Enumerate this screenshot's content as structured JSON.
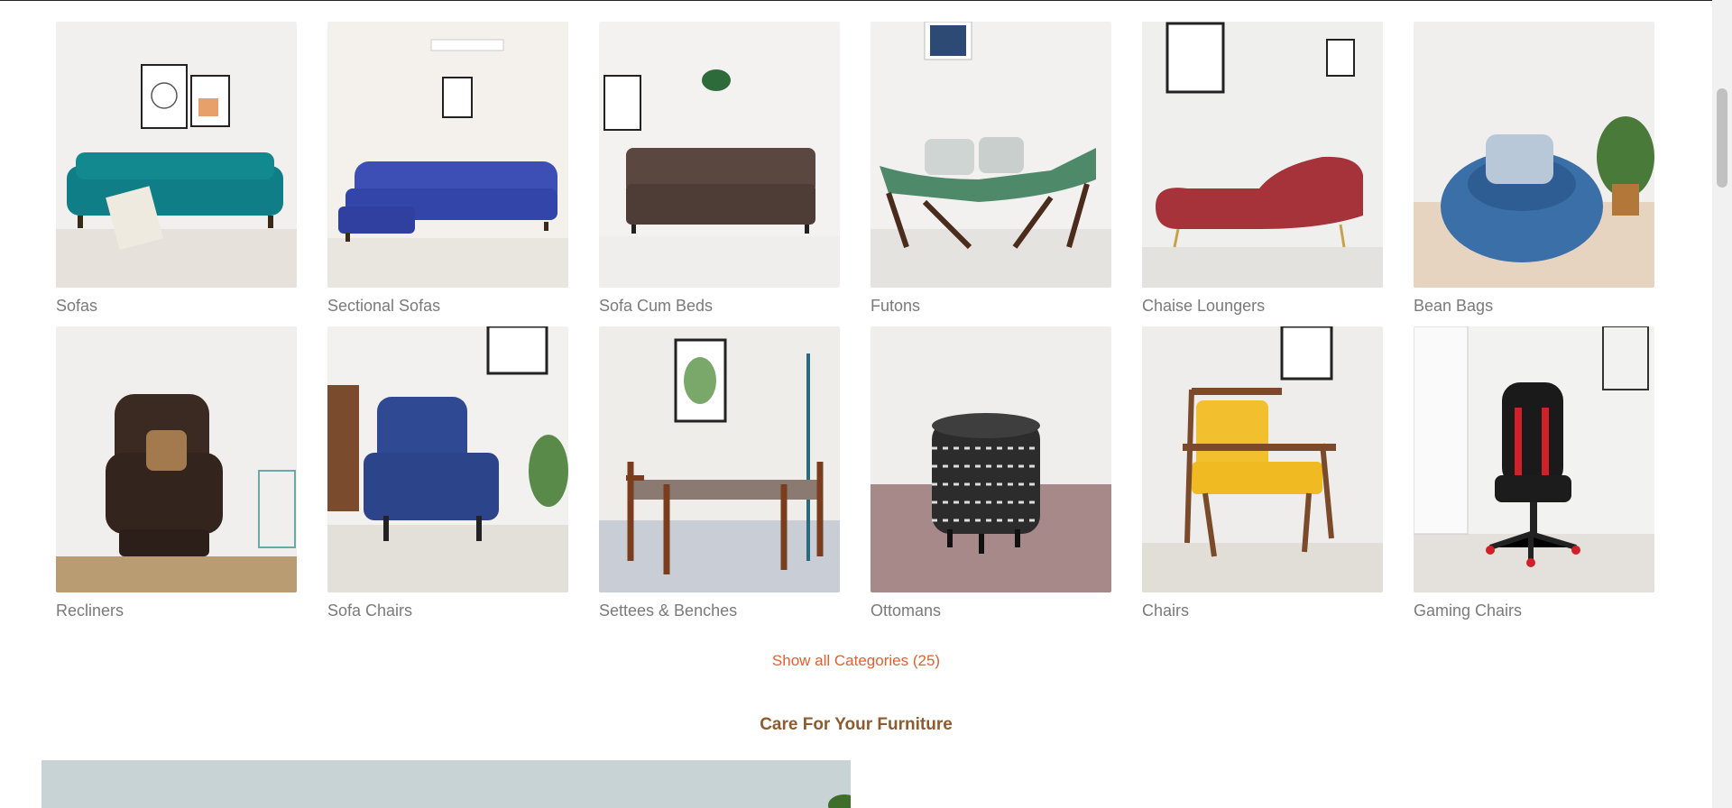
{
  "categories": [
    {
      "label": "Sofas",
      "icon": "sofa-teal-image"
    },
    {
      "label": "Sectional Sofas",
      "icon": "sectional-sofa-blue-image"
    },
    {
      "label": "Sofa Cum Beds",
      "icon": "sofa-cum-bed-brown-image"
    },
    {
      "label": "Futons",
      "icon": "futon-green-image"
    },
    {
      "label": "Chaise Loungers",
      "icon": "chaise-lounger-red-image"
    },
    {
      "label": "Bean Bags",
      "icon": "bean-bag-blue-image"
    },
    {
      "label": "Recliners",
      "icon": "recliner-brown-image"
    },
    {
      "label": "Sofa Chairs",
      "icon": "sofa-chair-blue-image"
    },
    {
      "label": "Settees & Benches",
      "icon": "settee-bench-image"
    },
    {
      "label": "Ottomans",
      "icon": "ottoman-patterned-image"
    },
    {
      "label": "Chairs",
      "icon": "chair-yellow-image"
    },
    {
      "label": "Gaming Chairs",
      "icon": "gaming-chair-red-black-image"
    }
  ],
  "show_all": "Show all Categories (25)",
  "section_title": "Care For Your Furniture",
  "colors": {
    "accent": "#e85e2c",
    "section_title": "#8f5b2e",
    "label": "#7a7a7a"
  }
}
